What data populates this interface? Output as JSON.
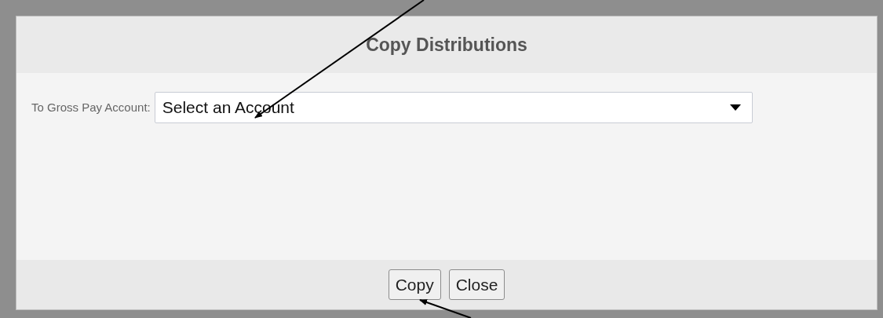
{
  "dialog": {
    "title": "Copy Distributions",
    "fields": [
      {
        "label": "To Gross Pay Account:",
        "value": "Select an Account"
      }
    ],
    "buttons": [
      "Copy",
      "Close"
    ]
  }
}
